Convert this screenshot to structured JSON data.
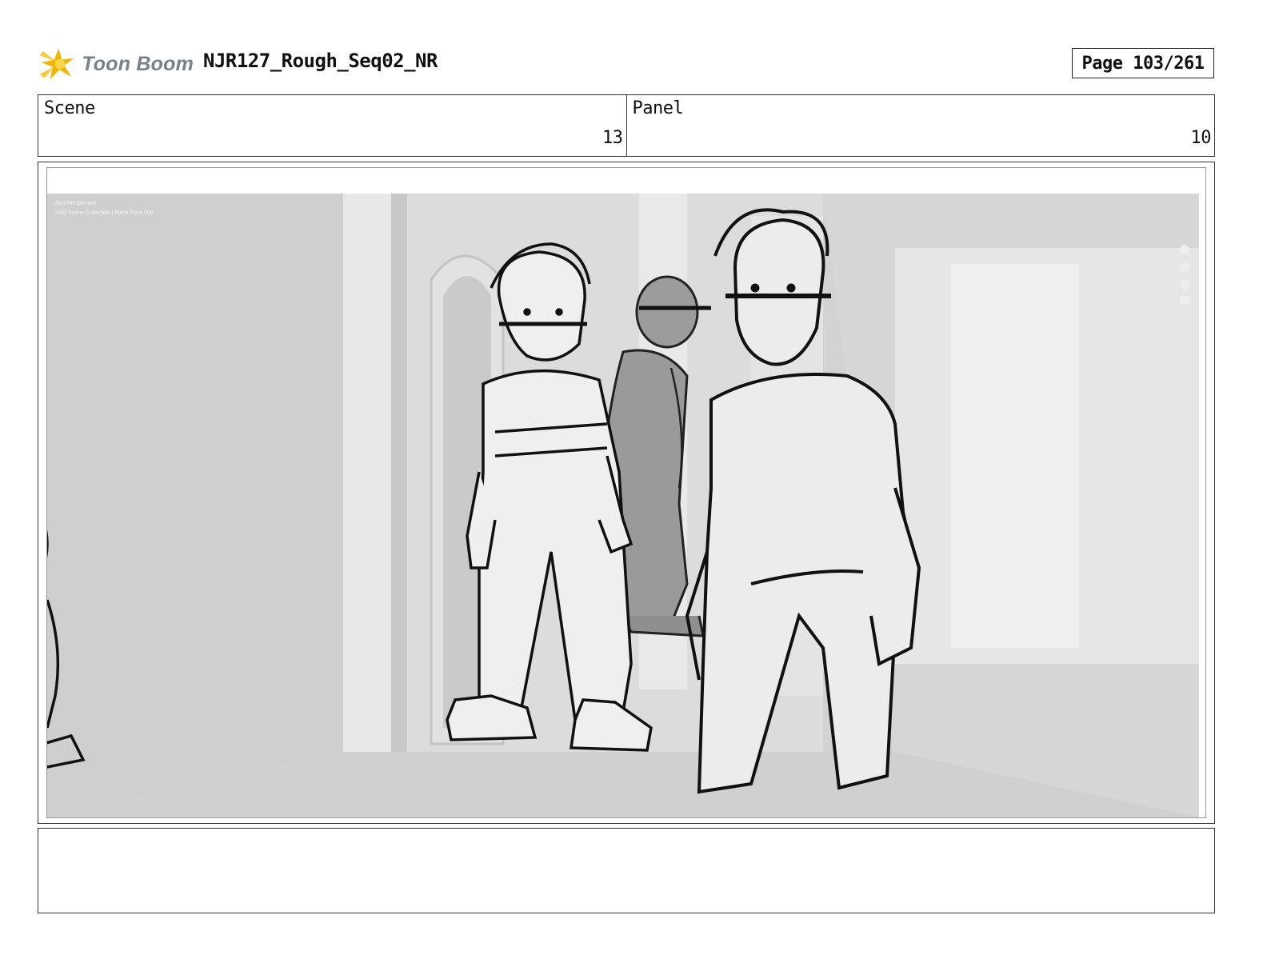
{
  "header": {
    "logo_text": "Toon Boom",
    "document_title": "NJR127_Rough_Seq02_NR",
    "page_indicator": "Page 103/261"
  },
  "info": {
    "scene_label": "Scene",
    "scene_value": "13",
    "panel_label": "Panel",
    "panel_value": "10"
  },
  "panel": {
    "viewport_line1": "User Perspective",
    "viewport_line2": "(158) Scene Collection | Mitch Pose.008"
  },
  "notes": {
    "text": ""
  },
  "colors": {
    "logo_star": "#f5b400",
    "logo_text": "#7b7f86",
    "border": "#333333",
    "viewport_bg": "#d2d2d2"
  }
}
